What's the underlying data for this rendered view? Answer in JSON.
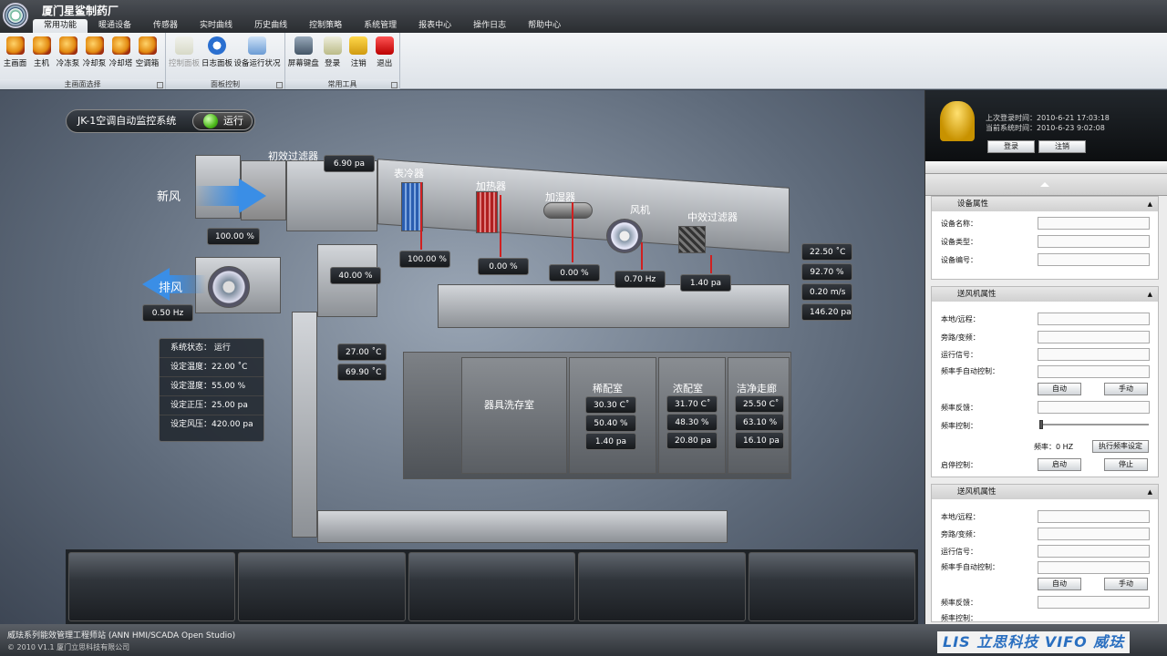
{
  "app": {
    "title": "厦门星鲨制药厂"
  },
  "menu": {
    "tabs": [
      "常用功能",
      "暖通设备",
      "传感器",
      "实时曲线",
      "历史曲线",
      "控制策略",
      "系统管理",
      "报表中心",
      "操作日志",
      "帮助中心"
    ]
  },
  "ribbon": {
    "group1": {
      "label": "主画面选择",
      "buttons": [
        "主画面",
        "主机",
        "冷冻泵",
        "冷却泵",
        "冷却塔",
        "空调箱"
      ]
    },
    "group2": {
      "label": "面板控制",
      "buttons": [
        "控制面板",
        "日志面板",
        "设备运行状况"
      ]
    },
    "group3": {
      "label": "常用工具",
      "buttons": [
        "屏幕键盘",
        "登录",
        "注销",
        "退出"
      ]
    }
  },
  "system": {
    "name": "JK-1空调自动监控系统",
    "state": "运行"
  },
  "labels": {
    "fresh_air": "新风",
    "exhaust": "排风",
    "pre_filter": "初效过滤器",
    "cooler": "表冷器",
    "heater": "加热器",
    "humidifier": "加湿器",
    "fan": "风机",
    "mid_filter": "中效过滤器"
  },
  "values": {
    "pre_filter_pa": "6.90 pa",
    "fresh_pct": "100.00 %",
    "mix_pct": "40.00 %",
    "exhaust_hz": "0.50 Hz",
    "cooler_pct": "100.00 %",
    "heater_pct": "0.00 %",
    "humid_pct": "0.00 %",
    "fan_hz": "0.70 Hz",
    "mid_filter_pa": "1.40 pa",
    "temp": "22.50 ˚C",
    "hum": "92.70 %",
    "speed": "0.20 m/s",
    "press": "146.20 pa",
    "return_t": "27.00 ˚C",
    "return_h": "69.90 ˚C"
  },
  "status": {
    "state": "系统状态： 运行",
    "set_temp": "设定温度：22.00 ˚C",
    "set_hum": "设定湿度：55.00 %",
    "set_press": "设定正压：25.00 pa",
    "set_air": "设定风压：420.00 pa"
  },
  "rooms": [
    {
      "name": "器具洗存室"
    },
    {
      "name": "稀配室",
      "t": "30.30 C˚",
      "h": "50.40 %",
      "p": "1.40 pa"
    },
    {
      "name": "浓配室",
      "t": "31.70 C˚",
      "h": "48.30 %",
      "p": "20.80 pa"
    },
    {
      "name": "洁净走廊",
      "t": "25.50 C˚",
      "h": "63.10 %",
      "p": "16.10 pa"
    }
  ],
  "login": {
    "last": "上次登录时间：2010-6-21 17:03:18",
    "now": "当前系统时间：2010-6-23 9:02:08",
    "login_btn": "登录",
    "logout_btn": "注销"
  },
  "device_props": {
    "title": "设备属性",
    "rows": [
      "设备名称：",
      "设备类型：",
      "设备编号："
    ]
  },
  "fan_props": {
    "title": "送风机属性",
    "rows": [
      "本地/远程：",
      "旁路/变频：",
      "运行信号：",
      "频率手自动控制："
    ],
    "auto": "自动",
    "manual": "手动",
    "feedback": "频率反馈：",
    "control": "频率控制：",
    "freq": "频率：0 HZ",
    "set_btn": "执行频率设定",
    "startstop": "启停控制：",
    "start": "启动",
    "stop": "停止"
  },
  "fan_props2": {
    "title": "送风机属性",
    "rows": [
      "本地/远程：",
      "旁路/变频：",
      "运行信号：",
      "频率手自动控制："
    ],
    "auto": "自动",
    "manual": "手动",
    "feedback": "频率反馈：",
    "control": "频率控制："
  },
  "footer": {
    "line1": "威珐系列能效管理工程师站 (ANN HMI/SCADA Open Studio)",
    "line2": "© 2010 V1.1 厦门立思科技有限公司",
    "logo": "LIS 立思科技 VIFO 威珐"
  },
  "colors": {
    "accent": "#2a6fc0",
    "run_green": "#4cb81a",
    "pipe_red": "#d02020",
    "air_blue": "#3a8ee6"
  }
}
